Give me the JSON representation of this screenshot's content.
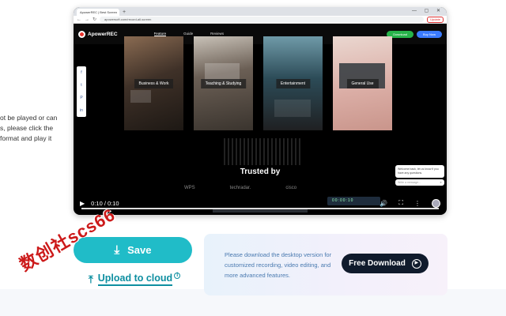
{
  "side_text": {
    "lines": [
      "ot be played or can",
      "s, please click the",
      "format and play it"
    ]
  },
  "browser": {
    "tab_label": "ApowerREC | Best Screen",
    "new_tab": "+",
    "window_controls": "— ▢ ✕",
    "url": "apowersoft.com/record-all-screen",
    "update_label": "Update"
  },
  "site": {
    "brand": "ApowerREC",
    "nav": [
      "Feature",
      "Guide",
      "Reviews"
    ],
    "download_label": "Download",
    "buy_label": "Buy Now"
  },
  "social": [
    "f",
    "t",
    "P",
    "in"
  ],
  "cards": [
    {
      "label": "Business & Work"
    },
    {
      "label": "Teaching & Studying"
    },
    {
      "label": "Entertainment"
    },
    {
      "label": "General Use"
    }
  ],
  "trusted": "Trusted by",
  "brands": [
    "WPS",
    "techradar.",
    "cisco"
  ],
  "chat": {
    "bubble": "Welcome back, let us know if you have any questions.",
    "placeholder": "Write a message..."
  },
  "rec_timer": "00:00:10",
  "player": {
    "play_icon": "▶",
    "time": "0:10 / 0:10",
    "progress": 1.0
  },
  "watermark": "数创社scs66",
  "actions": {
    "save_label": "Save",
    "upload_label": "Upload to cloud",
    "upload_info": "i"
  },
  "promo": {
    "text": "Please download the desktop version for customized recording, video editing, and more advanced features.",
    "button_label": "Free Download"
  },
  "colors": {
    "accent": "#20bcc8",
    "link": "#0e8fa1",
    "promo_text": "#4a7ab0",
    "dark_button": "#101b2c"
  }
}
